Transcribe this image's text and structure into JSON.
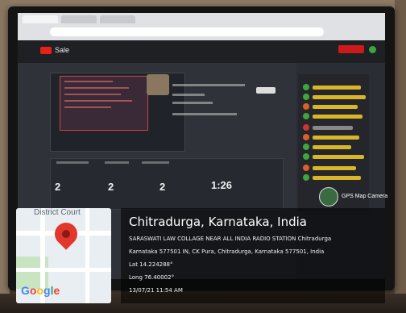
{
  "studio": {
    "title": "Sale"
  },
  "stats": {
    "values": [
      "2",
      "2",
      "2",
      "1:26"
    ]
  },
  "map_card": {
    "place_label": "District Court",
    "brand": "Google"
  },
  "gps_overlay": {
    "city": "Chitradurga, Karnataka, India",
    "address_line_1": "SARASWATI LAW COLLAGE NEAR ALL INDIA RADIO STATION Chitradurga",
    "address_line_2": "Karnataka 577501 IN, CK Pura, Chitradurga, Karnataka 577501, India",
    "latitude": "Lat 14.224288°",
    "longitude": "Long 76.40002°",
    "timestamp": "13/07/21 11:54 AM",
    "badge_label": "GPS Map Camera"
  },
  "colors": {
    "pin": "#e1372c",
    "google_blue": "#4285f4",
    "google_red": "#ea4335",
    "google_yellow": "#fbbc05",
    "google_green": "#34a853",
    "chat_highlight": "#d9b628"
  }
}
